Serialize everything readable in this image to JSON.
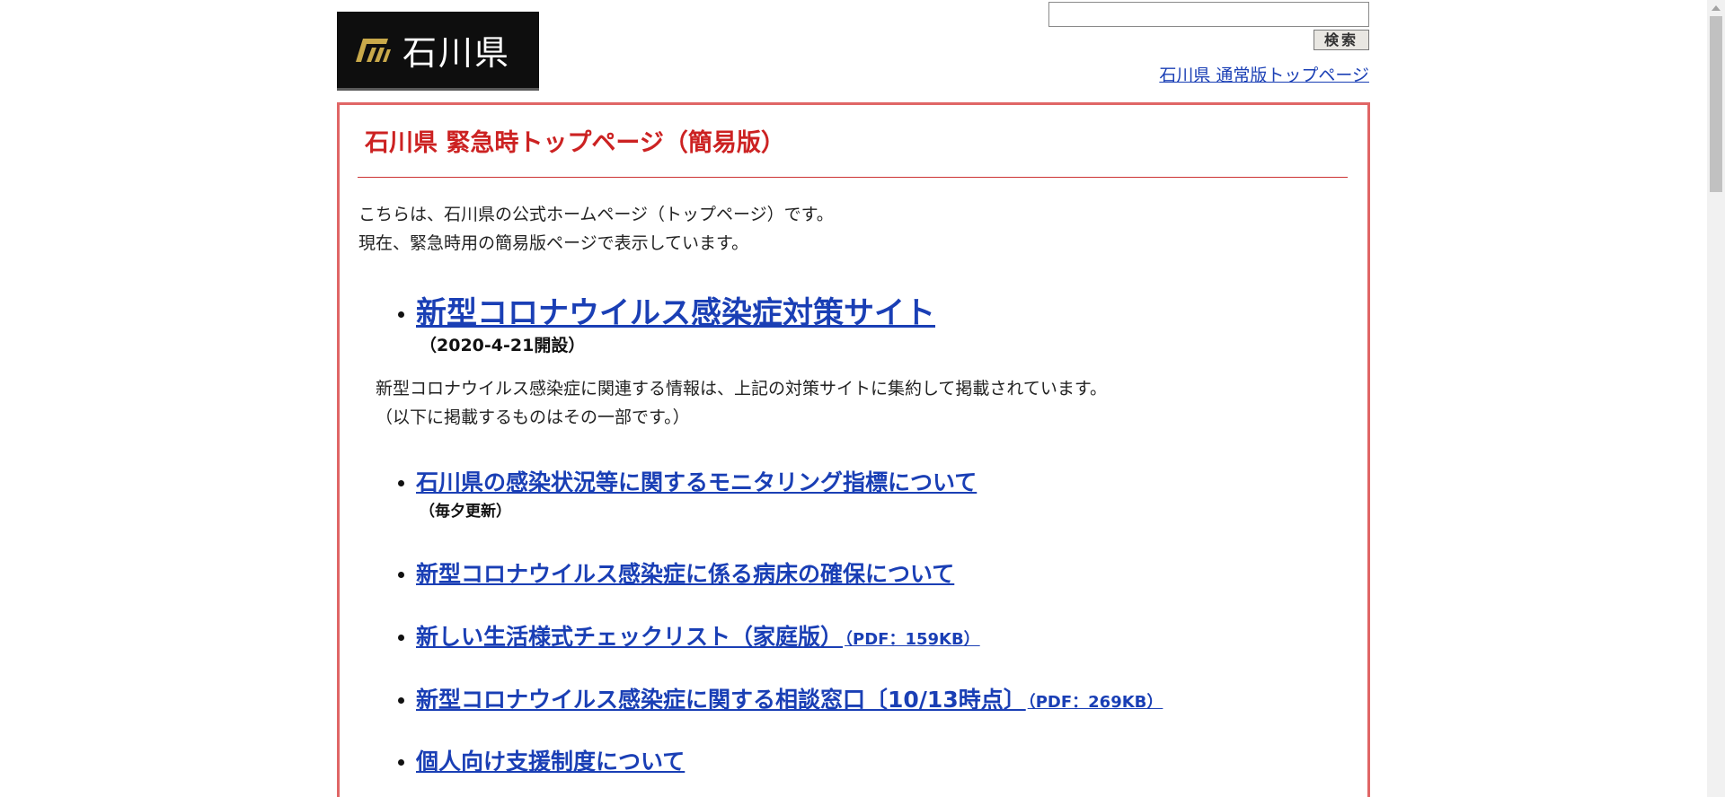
{
  "header": {
    "logo_text": "石川県",
    "search_placeholder": "",
    "search_button": "検索",
    "normal_top_link": "石川県 通常版トップページ"
  },
  "main": {
    "title": "石川県 緊急時トップページ（簡易版）",
    "intro_line1": "こちらは、石川県の公式ホームページ（トップページ）です。",
    "intro_line2": "現在、緊急時用の簡易版ページで表示しています。",
    "featured_link": "新型コロナウイルス感染症対策サイト",
    "featured_note": "（2020-4-21開設）",
    "desc_line1": "新型コロナウイルス感染症に関連する情報は、上記の対策サイトに集約して掲載されています。",
    "desc_line2": "（以下に掲載するものはその一部です。）",
    "links": [
      {
        "label": "石川県の感染状況等に関するモニタリング指標について",
        "note": "（毎夕更新）"
      },
      {
        "label": "新型コロナウイルス感染症に係る病床の確保について"
      },
      {
        "label": "新しい生活様式チェックリスト（家庭版）",
        "pdf": "（PDF：159KB）"
      },
      {
        "label": "新型コロナウイルス感染症に関する相談窓口〔10/13時点〕",
        "pdf": "（PDF：269KB）"
      },
      {
        "label": "個人向け支援制度について"
      }
    ]
  },
  "colors": {
    "accent_red": "#cc2222",
    "frame_border": "#e06666",
    "link_blue": "#1a3fb5",
    "logo_bg": "#0e0e0e",
    "logo_mark": "#c9a94a"
  }
}
